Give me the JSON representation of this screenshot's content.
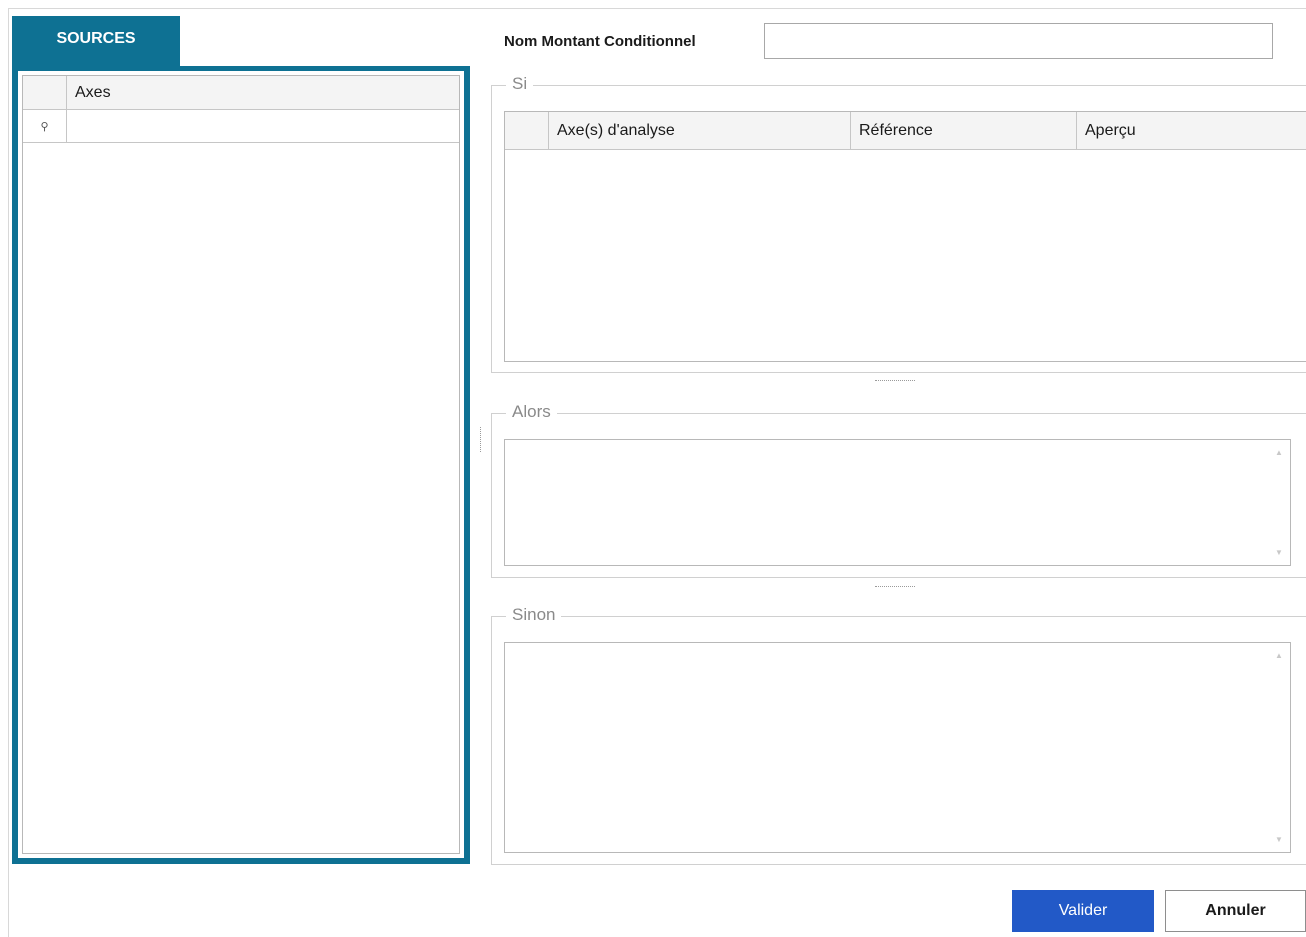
{
  "sources": {
    "tab_label": "SOURCES",
    "grid": {
      "columns": [
        "Axes"
      ],
      "filter_row_icon": "filter-pin-icon",
      "rows": []
    }
  },
  "form": {
    "name_label": "Nom Montant Conditionnel",
    "name_value": ""
  },
  "si": {
    "title": "Si",
    "columns": [
      "Axe(s) d'analyse",
      "Référence",
      "Aperçu"
    ],
    "rows": []
  },
  "alors": {
    "title": "Alors",
    "value": ""
  },
  "sinon": {
    "title": "Sinon",
    "value": ""
  },
  "buttons": {
    "ok": "Valider",
    "cancel": "Annuler"
  },
  "colors": {
    "accent": "#0e7193",
    "primary_button": "#2259c7"
  }
}
